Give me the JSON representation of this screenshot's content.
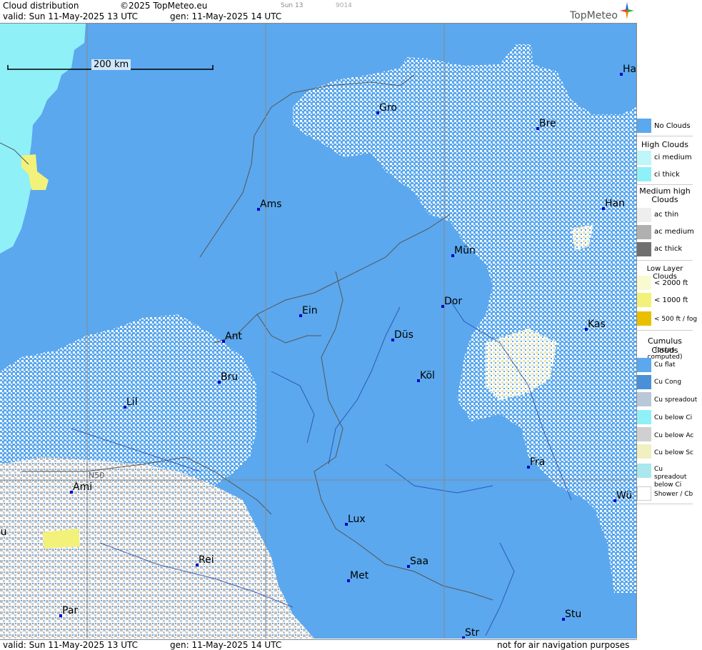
{
  "header": {
    "product": "Cloud distribution",
    "copyright": "©2025 TopMeteo.eu",
    "run_short": "Sun 13",
    "code": "9014",
    "valid": "valid:  Sun  11-May-2025  13 UTC",
    "generated": "gen: 11-May-2025 14 UTC",
    "logo": "TopMeteo"
  },
  "footer": {
    "valid": "valid:  Sun  11-May-2025  13 UTC",
    "generated": "gen: 11-May-2025 14 UTC",
    "disclaimer": "not for air navigation purposes"
  },
  "map": {
    "scale_label": "200 km",
    "grid_label": "N50",
    "cities": [
      {
        "name": "Gro"
      },
      {
        "name": "Bre"
      },
      {
        "name": "Ha"
      },
      {
        "name": "Ams"
      },
      {
        "name": "Han"
      },
      {
        "name": "Mün"
      },
      {
        "name": "Ein"
      },
      {
        "name": "Dor"
      },
      {
        "name": "Ant"
      },
      {
        "name": "Düs"
      },
      {
        "name": "Kas"
      },
      {
        "name": "Bru"
      },
      {
        "name": "Köl"
      },
      {
        "name": "Lil"
      },
      {
        "name": "Fra"
      },
      {
        "name": "Ami"
      },
      {
        "name": "Wü"
      },
      {
        "name": "Lux"
      },
      {
        "name": "ou"
      },
      {
        "name": "Rei"
      },
      {
        "name": "Saa"
      },
      {
        "name": "Met"
      },
      {
        "name": "Par"
      },
      {
        "name": "Stu"
      },
      {
        "name": "Str"
      }
    ],
    "colors": {
      "no_clouds": "#5ba8ee",
      "cu_flat": "#ffffff",
      "ci": "#8ff0f8",
      "low": "#f8f8a0",
      "ac": "#b8b8b8",
      "marker": "#0000cc"
    }
  },
  "legend": {
    "no_clouds": "No Clouds",
    "high_head": "High Clouds",
    "ci_medium": "ci medium",
    "ci_thick": "ci thick",
    "medium_head": "Medium high Clouds",
    "ac_thin": "ac thin",
    "ac_medium": "ac medium",
    "ac_thick": "ac thick",
    "low_head": "Low Layer Clouds",
    "low_2000": "< 2000 ft",
    "low_1000": "< 1000 ft",
    "low_500": "< 500 ft / fog",
    "cu_head": "Cumulus Clouds",
    "cu_sub": "(octas computed)",
    "cu_flat": "Cu flat",
    "cu_cong": "Cu Cong",
    "cu_spreadout": "Cu spreadout",
    "cu_below_ci": "Cu below Ci",
    "cu_below_ac": "Cu below Ac",
    "cu_below_sc": "Cu below Sc",
    "cu_spreadout_below_ci": "Cu spreadout below Ci",
    "shower": "Shower / Cb"
  }
}
